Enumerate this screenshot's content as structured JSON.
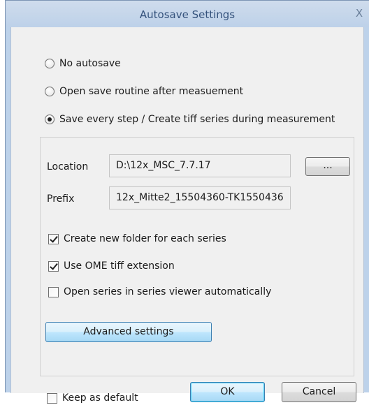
{
  "window": {
    "title": "Autosave Settings",
    "close_label": "X"
  },
  "mode": {
    "options": [
      {
        "label": "No autosave",
        "selected": false
      },
      {
        "label": "Open save routine after measuement",
        "selected": false
      },
      {
        "label": "Save every step  / Create tiff series during measurement",
        "selected": true
      }
    ]
  },
  "series": {
    "location_label": "Location",
    "location_value": "D:\\12x_MSC_7.7.17",
    "browse_label": "...",
    "prefix_label": "Prefix",
    "prefix_value": "12x_Mitte2_15504360-TK1550436",
    "checkboxes": [
      {
        "label": "Create new folder for each series",
        "checked": true
      },
      {
        "label": "Use OME tiff extension",
        "checked": true
      },
      {
        "label": "Open series in series viewer automatically",
        "checked": false
      }
    ],
    "advanced_label": "Advanced settings"
  },
  "footer": {
    "keep_default_label": "Keep as default",
    "keep_default_checked": false,
    "ok_label": "OK",
    "cancel_label": "Cancel"
  }
}
